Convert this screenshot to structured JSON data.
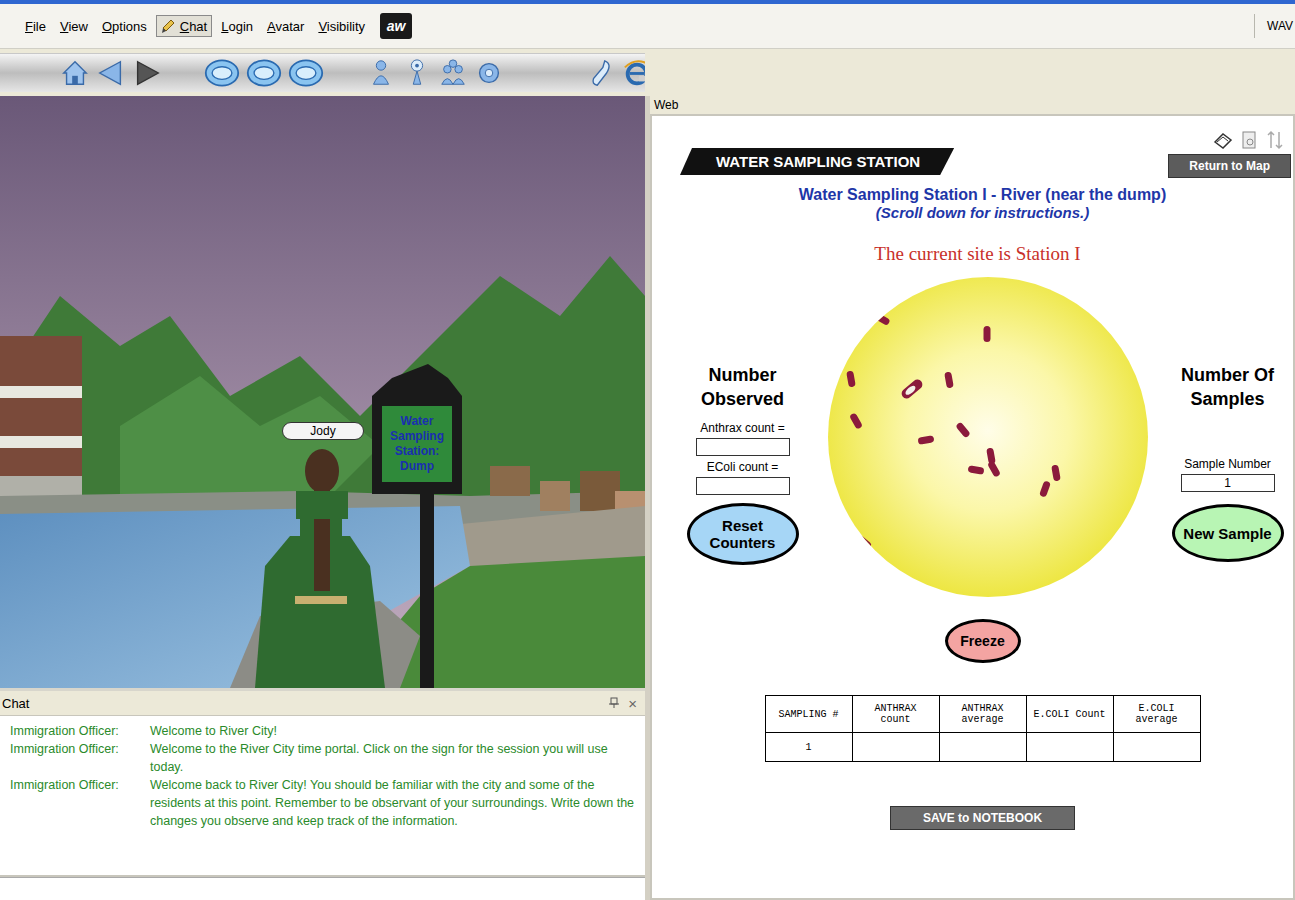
{
  "menu": [
    {
      "label": "File",
      "selected": false
    },
    {
      "label": "View",
      "selected": false
    },
    {
      "label": "Options",
      "selected": false
    },
    {
      "label": "Chat",
      "selected": true
    },
    {
      "label": "Login",
      "selected": false
    },
    {
      "label": "Avatar",
      "selected": false
    },
    {
      "label": "Visibility",
      "selected": false
    }
  ],
  "logo": "aw",
  "right_menu": "WAV",
  "web_label": "Web",
  "scene": {
    "avatar_name": "Jody",
    "sign": "Water Sampling Station: Dump"
  },
  "chat": {
    "title": "Chat",
    "close": "×",
    "messages": [
      {
        "speaker": "Immigration Officer:",
        "text": "Welcome to River City!"
      },
      {
        "speaker": "Immigration Officer:",
        "text": "Welcome to the River City time portal. Click on the sign for the session you will use today."
      },
      {
        "speaker": "Immigration Officer:",
        "text": "Welcome back to River City!  You should be familiar with the city and some of the residents at this point.  Remember to be observant of your surroundings.  Write down the changes you observe and keep track of the information."
      }
    ]
  },
  "station": {
    "tab_title": "WATER SAMPLING STATION",
    "return_button": "Return to Map",
    "title": "Water Sampling Station I - River (near the dump)",
    "subtitle": "(Scroll down for instructions.)",
    "site": "The current site is Station I",
    "observed_heading": "Number Observed",
    "fields": [
      {
        "label": "Anthrax count =",
        "value": ""
      },
      {
        "label": "EColi count =",
        "value": ""
      }
    ],
    "reset_button": "Reset Counters",
    "samples_heading": "Number Of Samples",
    "sample_label": "Sample Number",
    "sample_value": "1",
    "new_sample_button": "New Sample",
    "freeze_button": "Freeze",
    "table": {
      "columns": [
        "SAMPLING #",
        "ANTHRAX count",
        "ANTHRAX average",
        "E.COLI Count",
        "E.COLI average"
      ],
      "rows": [
        [
          "1",
          "",
          "",
          "",
          ""
        ]
      ]
    },
    "save_button": "SAVE to NOTEBOOK"
  }
}
